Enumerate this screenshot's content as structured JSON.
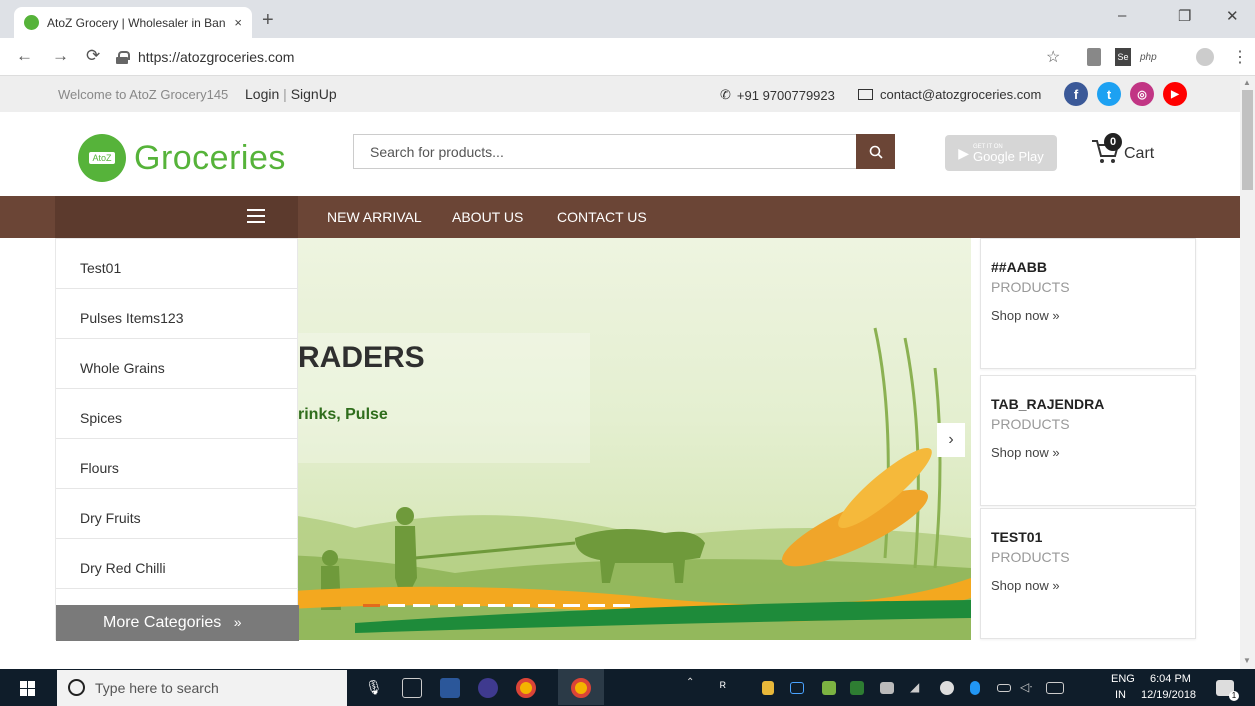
{
  "browser": {
    "tab_title": "AtoZ Grocery | Wholesaler in Ban",
    "tab_close": "×",
    "new_tab": "+",
    "url": "https://atozgroceries.com",
    "window_minimize": "–",
    "window_restore": "❐",
    "window_close": "✕",
    "ext_php": "php",
    "ext_se": "Se"
  },
  "topbar": {
    "welcome": "Welcome to AtoZ Grocery145",
    "login": "Login",
    "separator": "|",
    "signup": "SignUp",
    "phone": "+91 9700779923",
    "email": "contact@atozgroceries.com"
  },
  "header": {
    "logo_text": "Groceries",
    "logo_badge": "AtoZ",
    "search_placeholder": "Search for products...",
    "google_play_small": "GET IT ON",
    "google_play": "Google Play",
    "cart_count": "0",
    "cart_label": "Cart"
  },
  "nav": {
    "links": [
      "NEW ARRIVAL",
      "ABOUT US",
      "CONTACT US"
    ]
  },
  "categories": {
    "items": [
      "Test01",
      "Pulses Items123",
      "Whole Grains",
      "Spices",
      "Flours",
      "Dry Fruits",
      "Dry Red Chilli"
    ],
    "more": "More Categories",
    "more_arrow": "»"
  },
  "banner": {
    "heading": "RADERS",
    "subheading": "rinks, Pulse"
  },
  "promos": [
    {
      "title": "##AABB",
      "subtitle": "PRODUCTS",
      "link": "Shop now »"
    },
    {
      "title": "TAB_RAJENDRA",
      "subtitle": "PRODUCTS",
      "link": "Shop now »"
    },
    {
      "title": "TEST01",
      "subtitle": "PRODUCTS",
      "link": "Shop now »"
    }
  ],
  "taskbar": {
    "search_placeholder": "Type here to search",
    "lang1": "ENG",
    "lang2": "IN",
    "time": "6:04 PM",
    "date": "12/19/2018",
    "notifications": "1"
  },
  "colors": {
    "brand_green": "#56b33a",
    "nav_brown": "#6b4536",
    "facebook": "#3b5998",
    "twitter": "#1da1f2",
    "instagram": "#c13584",
    "youtube": "#ff0000"
  }
}
